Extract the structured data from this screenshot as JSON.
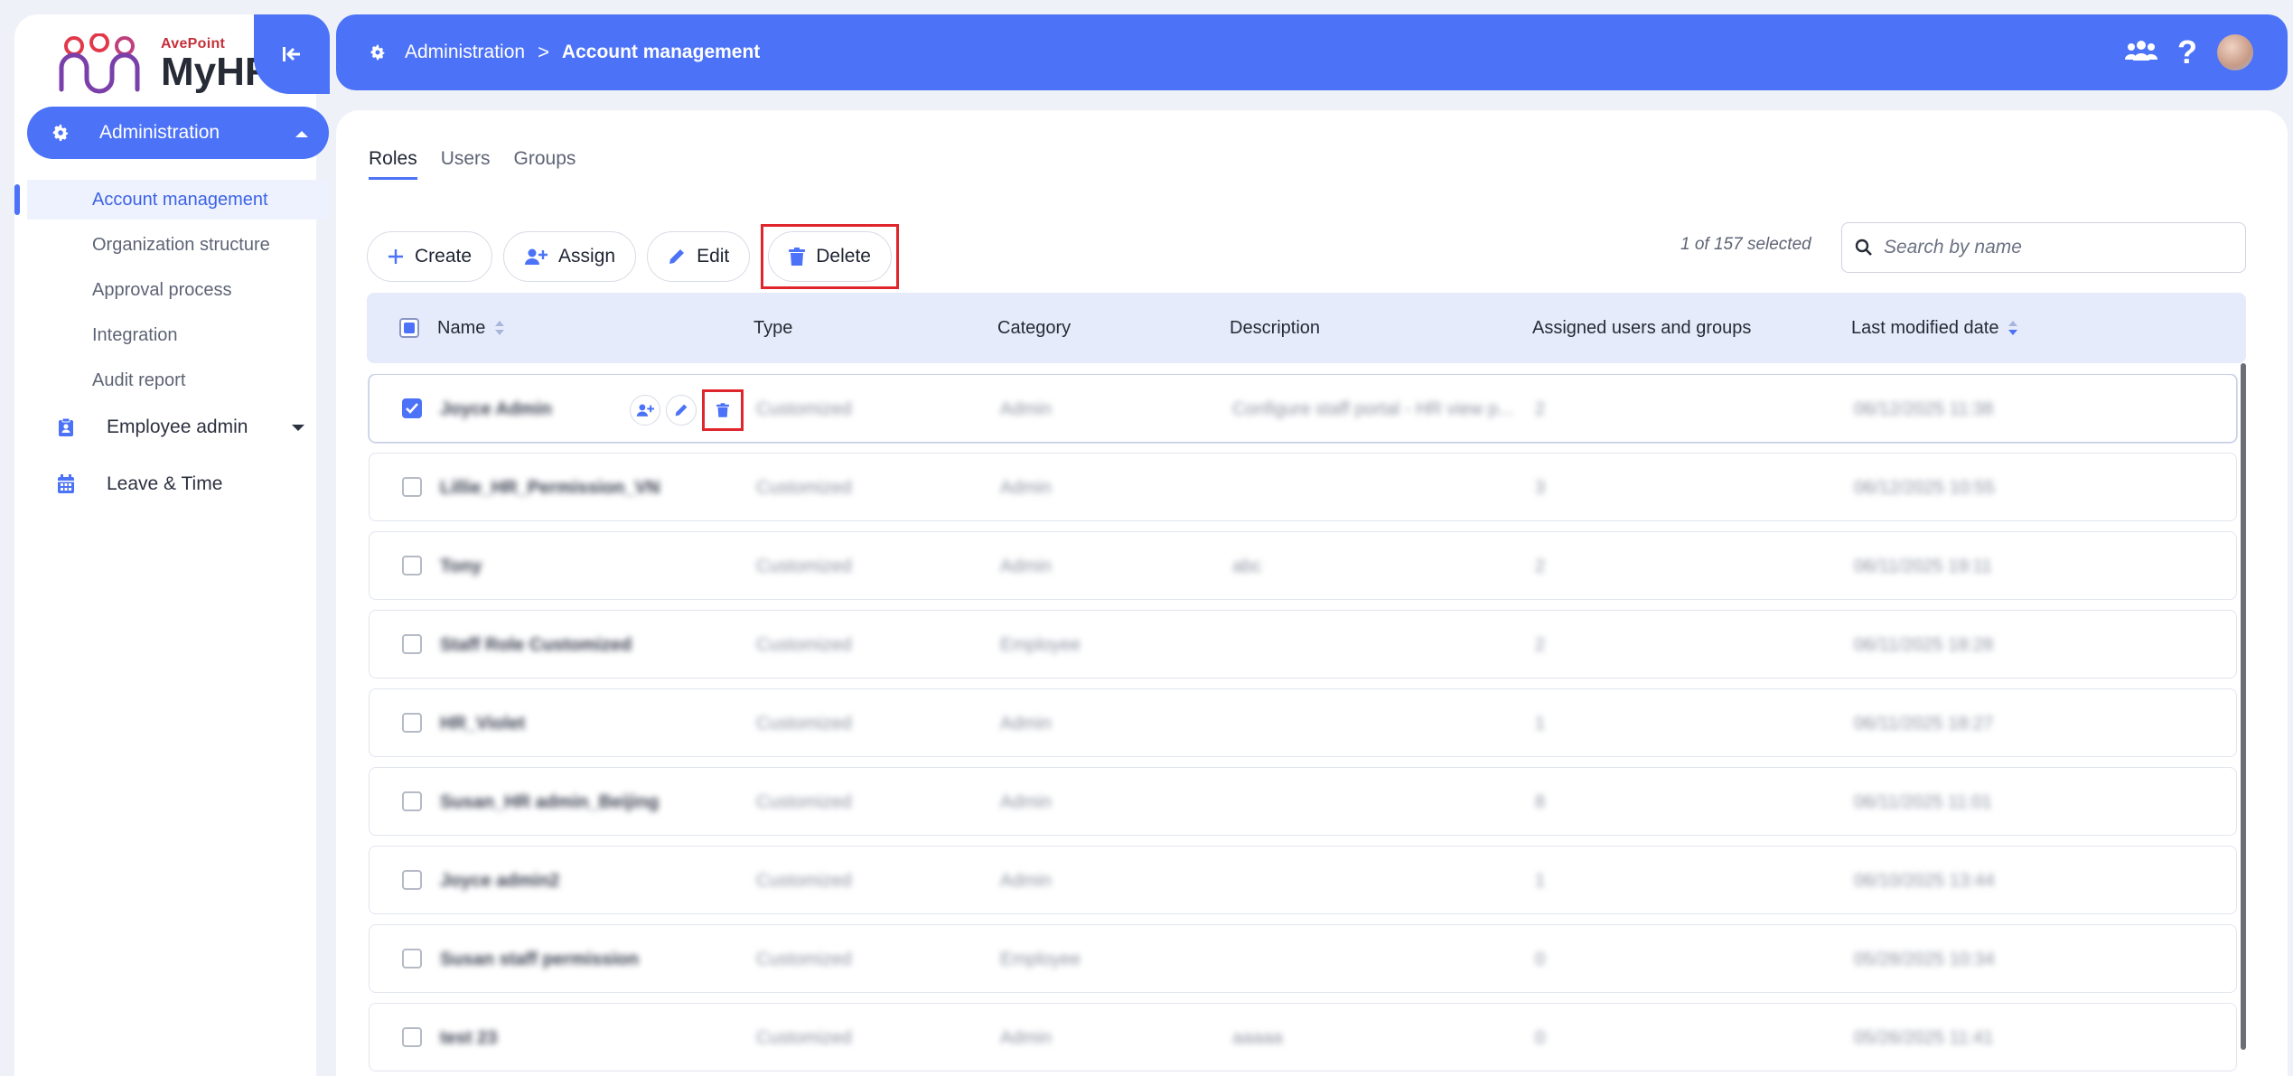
{
  "sidebar": {
    "logo_brand": "AvePoint",
    "logo_product": "MyHR",
    "admin_label": "Administration",
    "sub_items": [
      "Account management",
      "Organization structure",
      "Approval process",
      "Integration",
      "Audit report"
    ],
    "employee_admin_label": "Employee admin",
    "leave_time_label": "Leave & Time"
  },
  "header": {
    "crumb_root": "Administration",
    "crumb_sep": ">",
    "crumb_current": "Account management",
    "help_glyph": "?"
  },
  "tabs": [
    "Roles",
    "Users",
    "Groups"
  ],
  "toolbar": {
    "create": "Create",
    "assign": "Assign",
    "edit": "Edit",
    "delete": "Delete",
    "selected_count": "1 of 157 selected",
    "search_placeholder": "Search by name"
  },
  "table": {
    "columns": [
      "Name",
      "Type",
      "Category",
      "Description",
      "Assigned users and groups",
      "Last modified date"
    ],
    "rows": [
      {
        "name": "Joyce Admin",
        "type": "Customized",
        "category": "Admin",
        "description": "Configure staff portal - HR view p...",
        "assigned": "2",
        "modified": "06/12/2025 11:38"
      },
      {
        "name": "Lillie_HR_Permission_VN",
        "type": "Customized",
        "category": "Admin",
        "description": "",
        "assigned": "3",
        "modified": "06/12/2025 10:55"
      },
      {
        "name": "Tony",
        "type": "Customized",
        "category": "Admin",
        "description": "abc",
        "assigned": "2",
        "modified": "06/11/2025 19:11"
      },
      {
        "name": "Staff Role Customized",
        "type": "Customized",
        "category": "Employee",
        "description": "",
        "assigned": "2",
        "modified": "06/11/2025 18:28"
      },
      {
        "name": "HR_Violet",
        "type": "Customized",
        "category": "Admin",
        "description": "",
        "assigned": "1",
        "modified": "06/11/2025 18:27"
      },
      {
        "name": "Susan_HR admin_Beijing",
        "type": "Customized",
        "category": "Admin",
        "description": "",
        "assigned": "8",
        "modified": "06/11/2025 11:01"
      },
      {
        "name": "Joyce admin2",
        "type": "Customized",
        "category": "Admin",
        "description": "",
        "assigned": "1",
        "modified": "06/10/2025 13:44"
      },
      {
        "name": "Susan staff permission",
        "type": "Customized",
        "category": "Employee",
        "description": "",
        "assigned": "0",
        "modified": "05/28/2025 10:34"
      },
      {
        "name": "test 23",
        "type": "Customized",
        "category": "Admin",
        "description": "aaaaa",
        "assigned": "0",
        "modified": "05/26/2025 11:41"
      }
    ]
  },
  "colors": {
    "accent": "#4c72f7",
    "highlight_box": "#e0262d",
    "page_bg": "#eef1f8"
  }
}
